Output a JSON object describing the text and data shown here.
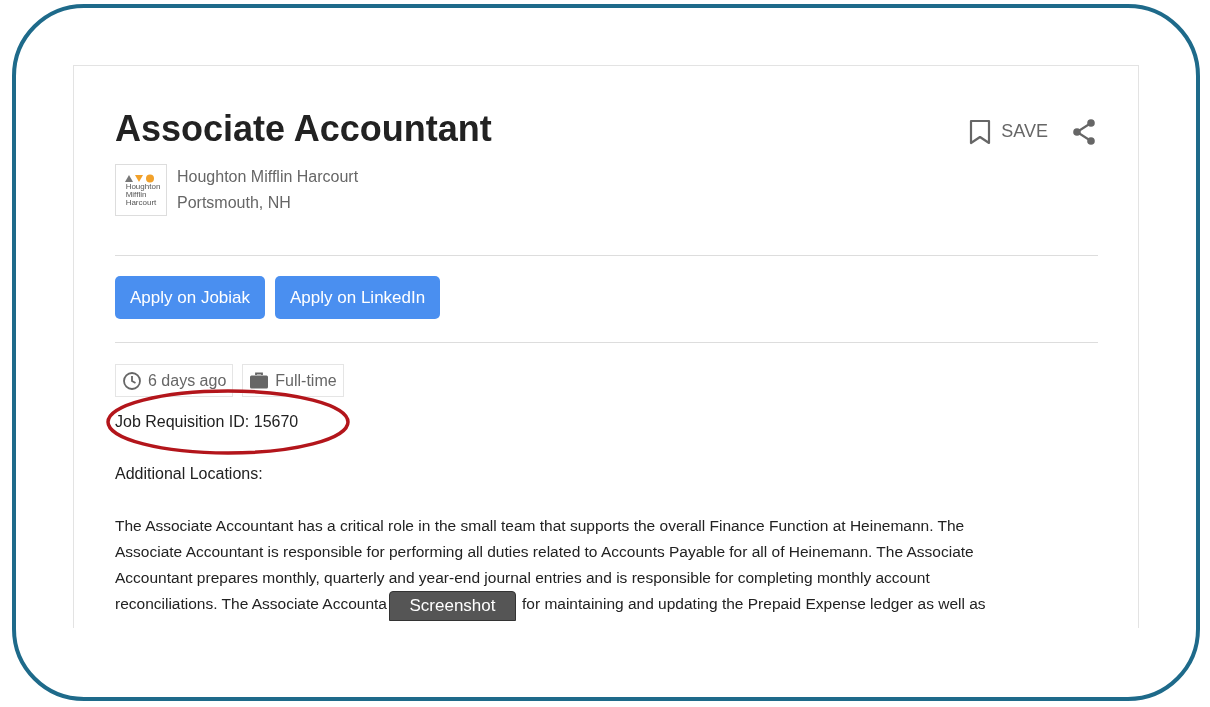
{
  "job": {
    "title": "Associate Accountant",
    "save_label": "SAVE",
    "company": "Houghton Mifflin Harcourt",
    "location": "Portsmouth, NH",
    "logo_lines": [
      "Houghton",
      "Mifflin",
      "Harcourt"
    ]
  },
  "apply_buttons": [
    "Apply on Jobiak",
    "Apply on LinkedIn"
  ],
  "tags": [
    {
      "kind": "time",
      "label": "6 days ago"
    },
    {
      "kind": "type",
      "label": "Full-time"
    }
  ],
  "requisition": "Job Requisition ID: 15670",
  "additional_locations": "Additional Locations:",
  "description_lines": [
    "The Associate Accountant has a critical role in the small team that supports the overall Finance Function at Heinemann. The",
    "Associate Accountant is responsible for performing all duties related to Accounts Payable for all of Heinemann. The Associate",
    "Accountant prepares monthly, quarterly and year-end journal entries and is responsible for completing monthly account"
  ],
  "description_last_line": {
    "before": "reconciliations. The Associate Accounta",
    "after": "for maintaining and updating the Prepaid Expense ledger as well as"
  },
  "tooltip": "Screenshot"
}
